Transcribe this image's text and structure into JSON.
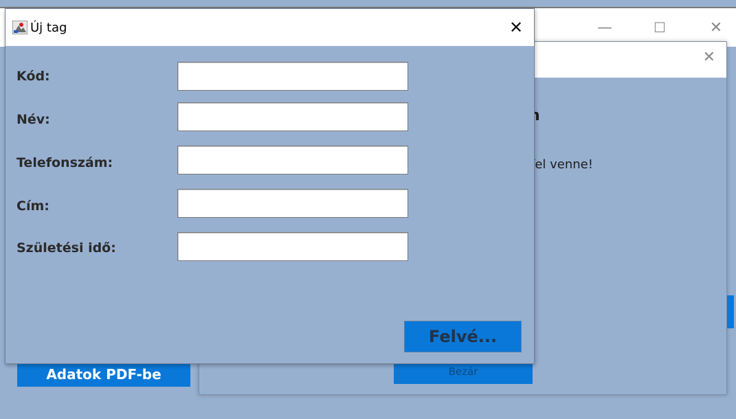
{
  "main_window": {
    "minimize_icon": "—",
    "maximize_icon": "☐",
    "close_icon": "✕",
    "pdf_button_label": "Adatok PDF-be"
  },
  "dialog2": {
    "close_icon": "✕",
    "heading_fragment": "n",
    "text_fragment": "fel venne!",
    "close_button_label": "Bezár"
  },
  "dialog1": {
    "title": "Új tag",
    "close_icon": "✕",
    "fields": [
      {
        "label": "Kód:",
        "value": ""
      },
      {
        "label": "Név:",
        "value": ""
      },
      {
        "label": "Telefonszám:",
        "value": ""
      },
      {
        "label": "Cím:",
        "value": ""
      },
      {
        "label": "Születési idő:",
        "value": ""
      }
    ],
    "add_button_label": "Felvé..."
  },
  "colors": {
    "background": "#98b0d0",
    "accent": "#0a78d8"
  }
}
